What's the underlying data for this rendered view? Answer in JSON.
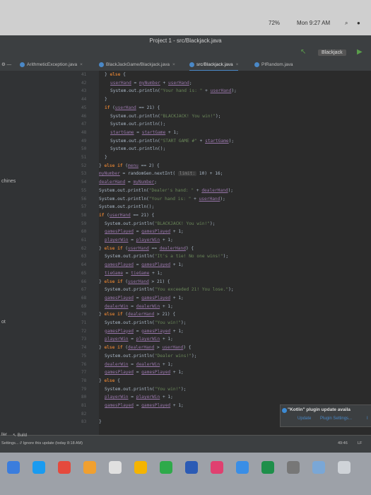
{
  "menubar": {
    "battery": "72%",
    "time": "Mon 9:27 AM"
  },
  "window": {
    "title": "Project 1 - src/Blackjack.java",
    "run_config": "Blackjack"
  },
  "tabs": [
    {
      "label": "ArithmeticException.java"
    },
    {
      "label": "BlackJackGame/Blackjack.java"
    },
    {
      "label": "src/Blackjack.java"
    },
    {
      "label": "PIRandom.java"
    }
  ],
  "side": {
    "label1": "chines",
    "label2": "ot"
  },
  "editor": {
    "lines": [
      {
        "n": "41",
        "indent": 3,
        "text": "} else {"
      },
      {
        "n": "42",
        "indent": 4,
        "text": "userHand = myNumber + userHand;"
      },
      {
        "n": "43",
        "indent": 4,
        "text": "System.out.println(\"Your hand is: \" + userHand);"
      },
      {
        "n": "44",
        "indent": 3,
        "text": "}"
      },
      {
        "n": "45",
        "indent": 3,
        "text": "if (userHand == 21) {"
      },
      {
        "n": "46",
        "indent": 4,
        "text": "System.out.println(\"BLACKJACK! You win!\");"
      },
      {
        "n": "47",
        "indent": 4,
        "text": "System.out.println();"
      },
      {
        "n": "48",
        "indent": 4,
        "text": "startGame = startGame + 1;"
      },
      {
        "n": "49",
        "indent": 4,
        "text": "System.out.println(\"START GAME #\" + startGame);"
      },
      {
        "n": "50",
        "indent": 4,
        "text": "System.out.println();"
      },
      {
        "n": "51",
        "indent": 3,
        "text": "}"
      },
      {
        "n": "52",
        "indent": 2,
        "text": "} else if (menu == 2) {"
      },
      {
        "n": "53",
        "indent": 2,
        "text": "myNumber = randomGen.nextInt( limit: 10) + 16;"
      },
      {
        "n": "54",
        "indent": 2,
        "text": "dealerHand = myNumber;"
      },
      {
        "n": "55",
        "indent": 2,
        "text": "System.out.println(\"Dealer's hand: \" + dealerHand);"
      },
      {
        "n": "56",
        "indent": 2,
        "text": "System.out.println(\"Your hand is: \" + userHand);"
      },
      {
        "n": "57",
        "indent": 2,
        "text": "System.out.println();"
      },
      {
        "n": "58",
        "indent": 2,
        "text": "if (userHand == 21) {"
      },
      {
        "n": "59",
        "indent": 3,
        "text": "System.out.println(\"BLACKJACK! You win!\");"
      },
      {
        "n": "60",
        "indent": 3,
        "text": "gamesPlayed = gamesPlayed + 1;"
      },
      {
        "n": "61",
        "indent": 3,
        "text": "playerWin = playerWin + 1;"
      },
      {
        "n": "62",
        "indent": 2,
        "text": "} else if (userHand == dealerHand) {"
      },
      {
        "n": "63",
        "indent": 3,
        "text": "System.out.println(\"It's a tie! No one wins!\");"
      },
      {
        "n": "64",
        "indent": 3,
        "text": "gamesPlayed = gamesPlayed + 1;"
      },
      {
        "n": "65",
        "indent": 3,
        "text": "tieGame = tieGame + 1;"
      },
      {
        "n": "66",
        "indent": 2,
        "text": "} else if (userHand > 21) {"
      },
      {
        "n": "67",
        "indent": 3,
        "text": "System.out.println(\"You exceeded 21! You lose.\");"
      },
      {
        "n": "68",
        "indent": 3,
        "text": "gamesPlayed = gamesPlayed + 1;"
      },
      {
        "n": "69",
        "indent": 3,
        "text": "dealerWin = dealerWin + 1;"
      },
      {
        "n": "70",
        "indent": 2,
        "text": "} else if (dealerHand > 21) {"
      },
      {
        "n": "71",
        "indent": 3,
        "text": "System.out.println(\"You win!\");"
      },
      {
        "n": "72",
        "indent": 3,
        "text": "gamesPlayed = gamesPlayed + 1;"
      },
      {
        "n": "73",
        "indent": 3,
        "text": "playerWin = playerWin + 1;"
      },
      {
        "n": "74",
        "indent": 2,
        "text": "} else if (dealerHand > userHand) {"
      },
      {
        "n": "75",
        "indent": 3,
        "text": "System.out.println(\"Dealer wins!\");"
      },
      {
        "n": "76",
        "indent": 3,
        "text": "dealerWin = dealerWin + 1;"
      },
      {
        "n": "77",
        "indent": 3,
        "text": "gamesPlayed = gamesPlayed + 1;"
      },
      {
        "n": "78",
        "indent": 2,
        "text": "} else {"
      },
      {
        "n": "79",
        "indent": 3,
        "text": "System.out.println(\"You win!\");"
      },
      {
        "n": "80",
        "indent": 3,
        "text": "playerWin = playerWin + 1;"
      },
      {
        "n": "81",
        "indent": 3,
        "text": "gamesPlayed = gamesPlayed + 1;"
      },
      {
        "n": "82",
        "indent": 2,
        "text": ""
      },
      {
        "n": "83",
        "indent": 2,
        "text": "}"
      }
    ]
  },
  "bottom": {
    "left_label": "ller",
    "build_label": "Build",
    "status": "Settings... // Ignore this update (today 8:18 AM)",
    "cursor": "49:46",
    "encoding": "LF"
  },
  "notification": {
    "title": "\"Kotlin\" plugin update availa",
    "update": "Update",
    "settings": "Plugin Settings...",
    "ignore": "I"
  },
  "dock": {
    "icons": [
      "finder-icon",
      "appstore-icon",
      "chrome-icon",
      "app-icon",
      "calendar-icon",
      "photos-icon",
      "facetime-icon",
      "word-icon",
      "intellij-icon",
      "bluetooth-icon",
      "excel-icon",
      "settings-icon",
      "folder-icon",
      "trash-icon"
    ]
  }
}
